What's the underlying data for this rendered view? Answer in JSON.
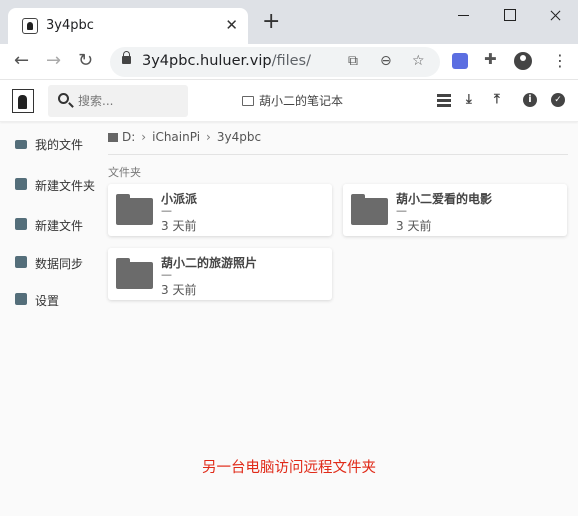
{
  "browser": {
    "tab_title": "3y4pbc",
    "tab_close": "✕",
    "new_tab": "+",
    "url_host": "3y4pbc.huluer.vip",
    "url_path": "/files/"
  },
  "app": {
    "search_placeholder": "搜索...",
    "notebook_label": "葫小二的笔记本"
  },
  "sidebar": {
    "items": [
      {
        "label": "我的文件",
        "icon": "folder-icon"
      },
      {
        "label": "新建文件夹",
        "icon": "folder-plus-icon"
      },
      {
        "label": "新建文件",
        "icon": "file-plus-icon"
      },
      {
        "label": "数据同步",
        "icon": "sync-icon"
      },
      {
        "label": "设置",
        "icon": "settings-icon"
      }
    ]
  },
  "breadcrumb": {
    "items": [
      "D:",
      "iChainPi",
      "3y4pbc"
    ],
    "separator": "›"
  },
  "section_label": "文件夹",
  "folders": [
    {
      "name": "小派派",
      "size": "—",
      "modified": "3 天前"
    },
    {
      "name": "葫小二爱看的电影",
      "size": "—",
      "modified": "3 天前"
    },
    {
      "name": "葫小二的旅游照片",
      "size": "—",
      "modified": "3 天前"
    }
  ],
  "caption": "另一台电脑访问远程文件夹",
  "colors": {
    "caption": "#e02a18",
    "folder": "#6b6b6b",
    "sidebar_icon": "#546e7a"
  }
}
